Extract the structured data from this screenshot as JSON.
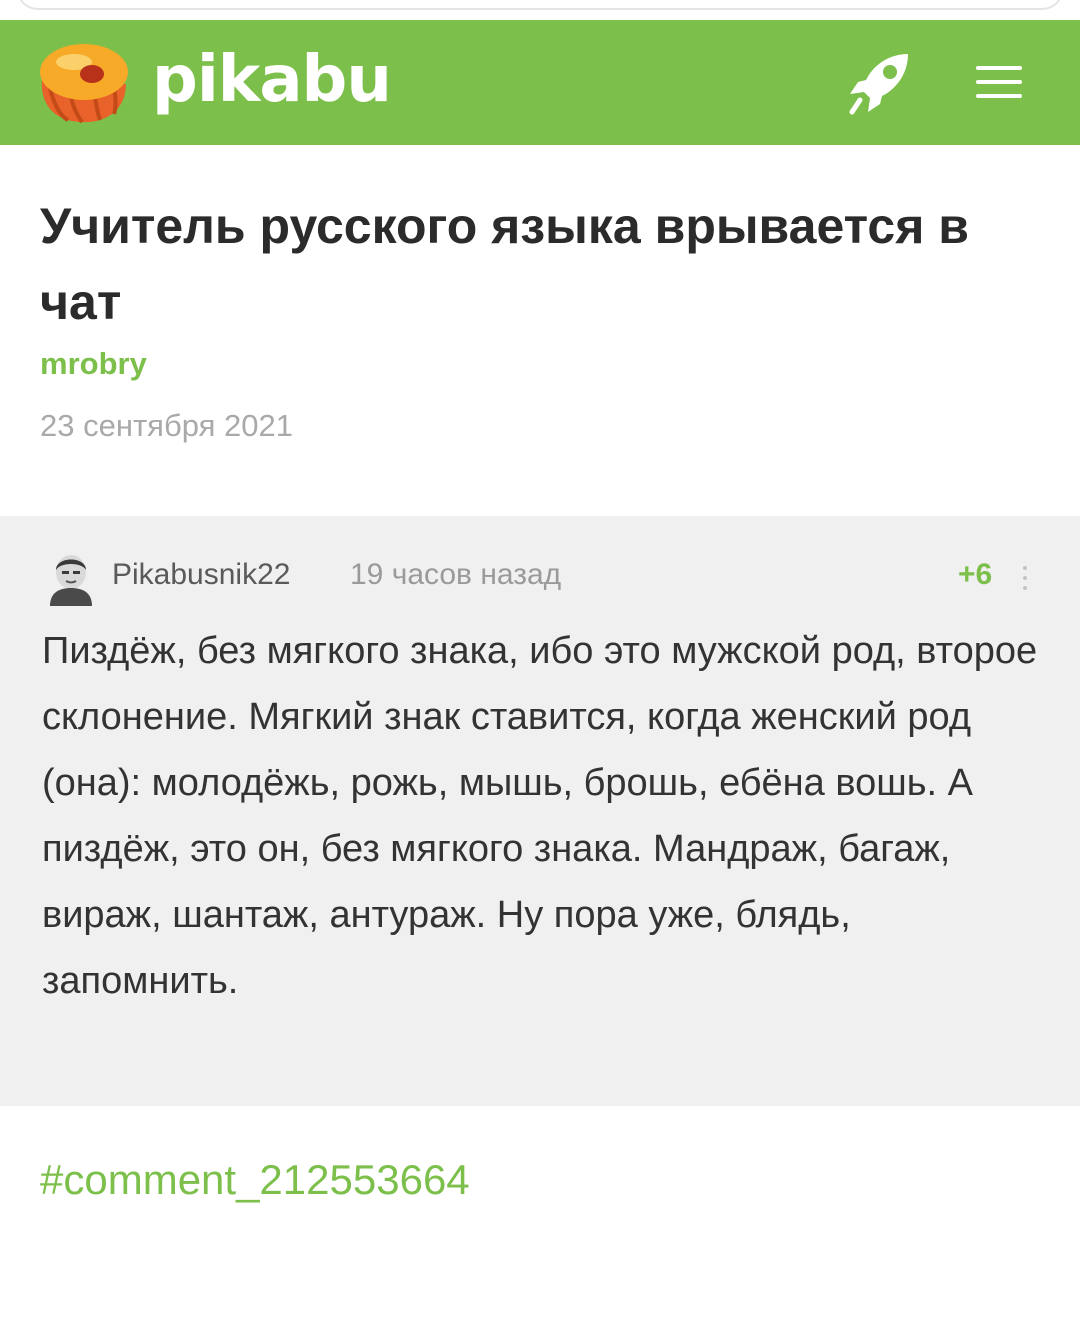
{
  "app": {
    "brand": "pikabu"
  },
  "header": {
    "icons": [
      "pikabu-logo-icon",
      "rocket-icon",
      "hamburger-menu-icon"
    ],
    "background_color": "#7cbf4a"
  },
  "post": {
    "title": "Учитель русского языка врывается в чат",
    "author": "mrobry",
    "date": "23 сентября 2021"
  },
  "comment": {
    "author": "Pikabusnik22",
    "time": "19 часов назад",
    "rating": "+6",
    "text": "Пиздёж, без мягкого знака, ибо это мужской род, второе склонение. Мягкий знак ставится, когда женский род (она): молодёжь, рожь, мышь, брошь, ебёна вошь. А пиздёж, это он, без мягкого знака. Мандраж, багаж, вираж, шантаж, антураж. Ну пора уже, блядь, запомнить.",
    "background_color": "#f0f0f0"
  },
  "hashtag": "#comment_212553664",
  "colors": {
    "accent": "#7cbf4a",
    "title": "#2b2b2b",
    "muted": "#a9a9a9"
  }
}
